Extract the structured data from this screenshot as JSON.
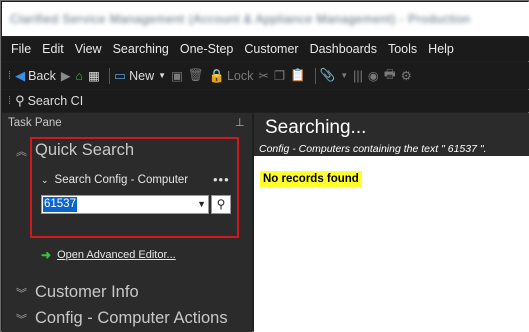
{
  "titlebar": {
    "text": "Clarified Service Management (Account & Appliance Management) - Production"
  },
  "menu": [
    "File",
    "Edit",
    "View",
    "Searching",
    "One-Step",
    "Customer",
    "Dashboards",
    "Tools",
    "Help"
  ],
  "toolbar": {
    "back_label": "Back",
    "new_label": "New",
    "lock_label": "Lock",
    "search_ci_label": "Search CI"
  },
  "task_pane": {
    "header": "Task Pane",
    "quick_search": {
      "title": "Quick Search",
      "sub_label": "Search Config - Computer",
      "more": "•••",
      "input_value": "61537"
    },
    "advanced_link": "Open Advanced Editor...",
    "sections": [
      "Customer Info",
      "Config - Computer Actions"
    ]
  },
  "content": {
    "title": "Searching...",
    "subtitle": "Config - Computers containing the text \" 61537 \".",
    "no_records": "No records found"
  },
  "colors": {
    "highlight_box": "#d0191c",
    "no_records_bg": "#ffff2a",
    "selection": "#0a64d0"
  }
}
